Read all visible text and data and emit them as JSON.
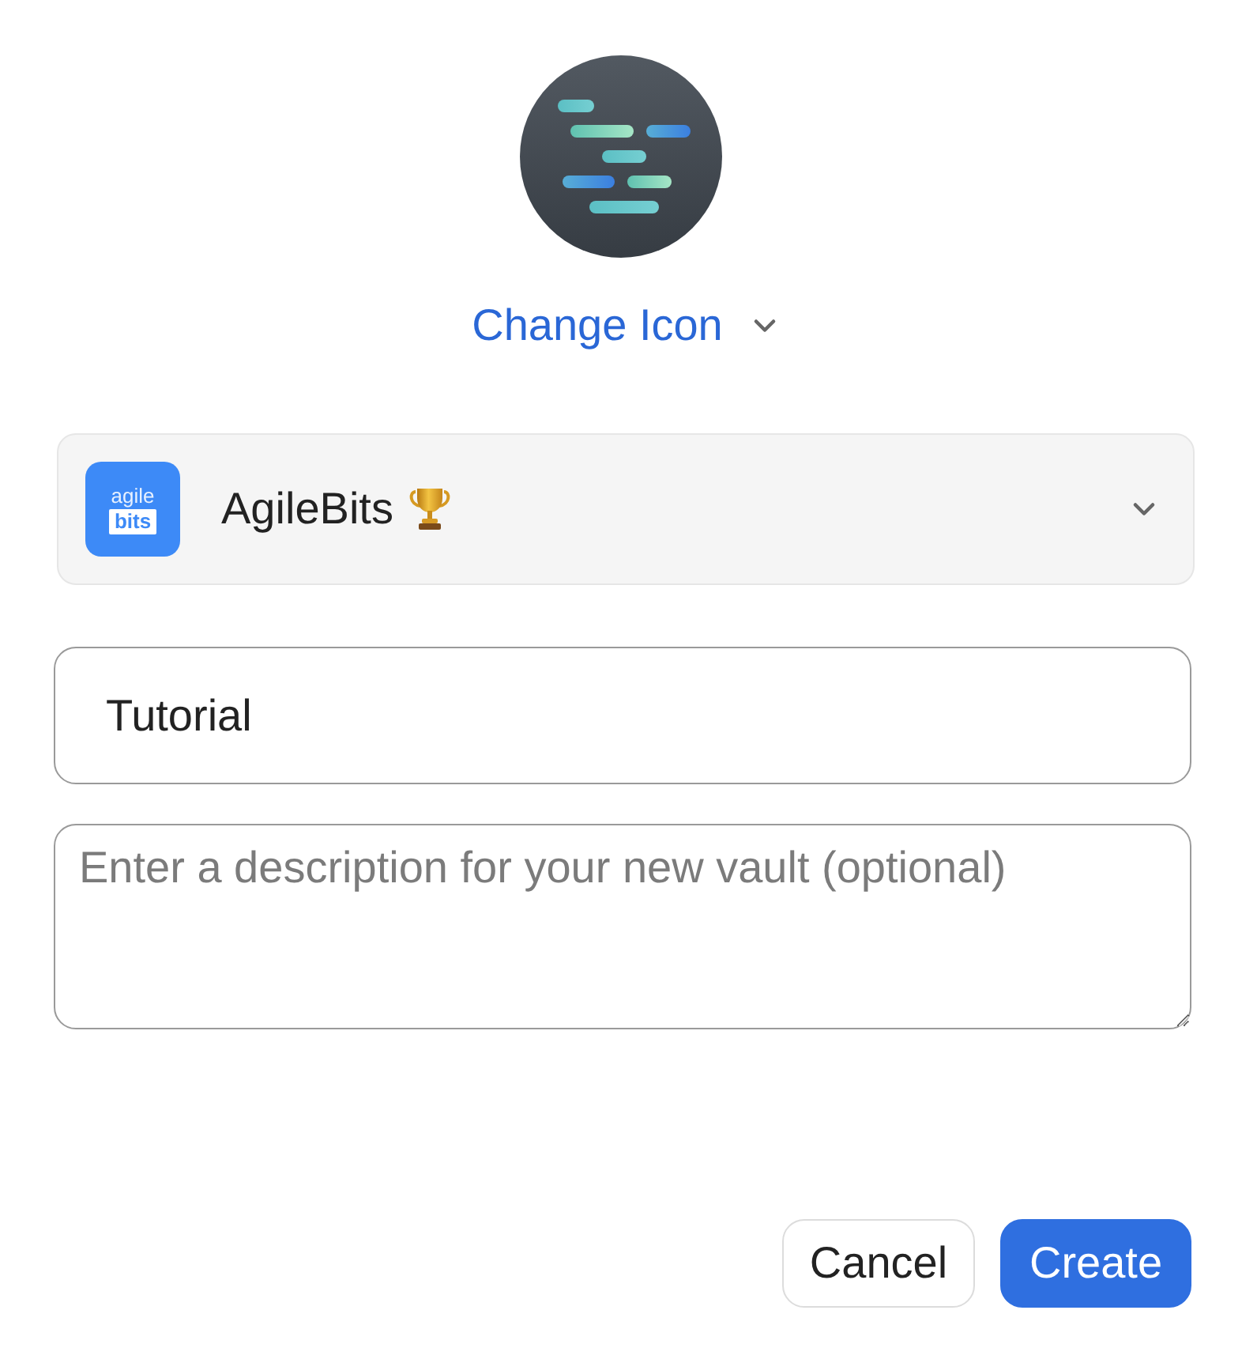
{
  "change_icon": {
    "label": "Change Icon"
  },
  "account_select": {
    "logo_text": [
      "agile",
      "bits"
    ],
    "value": "AgileBits"
  },
  "name_field": {
    "value": "Tutorial"
  },
  "description_field": {
    "placeholder": "Enter a description for your new vault (optional)"
  },
  "buttons": [
    {
      "label": "Cancel",
      "kind": "secondary"
    },
    {
      "label": "Create",
      "kind": "primary"
    }
  ]
}
